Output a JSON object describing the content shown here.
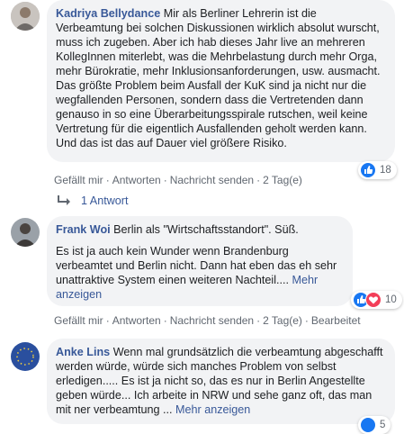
{
  "comments": [
    {
      "author": "Kadriya Bellydance",
      "text": "Mir als Berliner Lehrerin ist die Verbeamtung bei solchen Diskussionen wirklich absolut wurscht, muss ich zugeben. Aber ich hab dieses Jahr live an mehreren KollegInnen miterlebt, was die Mehrbelastung durch mehr Orga, mehr Bürokratie, mehr Inklusionsanforderungen, usw. ausmacht. Das größte Problem beim Ausfall der KuK sind ja nicht nur die wegfallenden Personen, sondern dass die Vertretenden dann genauso in so eine Überarbeitungsspirale rutschen, weil keine Vertretung für die eigentlich Ausfallenden geholt werden kann. Und das ist das auf Dauer viel größere Risiko.",
      "actions": [
        "Gefällt mir",
        "Antworten",
        "Nachricht senden",
        "2 Tag(e)"
      ],
      "reaction_count": "18",
      "replies_label": "1 Antwort"
    },
    {
      "author": "Frank Woi",
      "text": "Berlin als \"Wirtschaftsstandort\". Süß.",
      "text2": "Es ist ja auch kein Wunder wenn Brandenburg verbeamtet und Berlin nicht. Dann hat eben das eh sehr unattraktive System einen weiteren Nachteil....",
      "more": "Mehr anzeigen",
      "actions": [
        "Gefällt mir",
        "Antworten",
        "Nachricht senden",
        "2 Tag(e)",
        "Bearbeitet"
      ],
      "reaction_count": "10"
    },
    {
      "author": "Anke Lins",
      "text": "Wenn mal grundsätzlich die verbeamtung abgeschafft werden würde, würde sich manches Problem von selbst erledigen..... Es ist ja nicht so, das es nur in Berlin Angestellte geben würde... Ich arbeite in NRW und sehe ganz oft, das man mit ner verbeamtung ...",
      "more": "Mehr anzeigen",
      "reaction_count": "5"
    }
  ],
  "icons": {
    "like": "thumbs-up-icon",
    "love": "heart-icon",
    "reply": "reply-arrow-icon"
  },
  "colors": {
    "link": "#385898",
    "bubble": "#f2f3f5",
    "like": "#1877f2",
    "love": "#f33e58"
  }
}
